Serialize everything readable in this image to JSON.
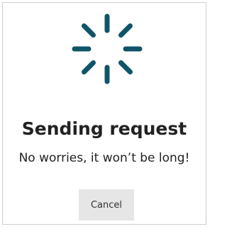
{
  "dialog": {
    "title": "Sending request",
    "message": "No worries, it won’t be long!",
    "cancel_label": "Cancel"
  },
  "spinner": {
    "icon": "loading-spinner-icon",
    "color": "#0f5567"
  },
  "colors": {
    "text": "#222222",
    "button_bg": "#e6e6e6",
    "border": "#cfcfcf"
  }
}
